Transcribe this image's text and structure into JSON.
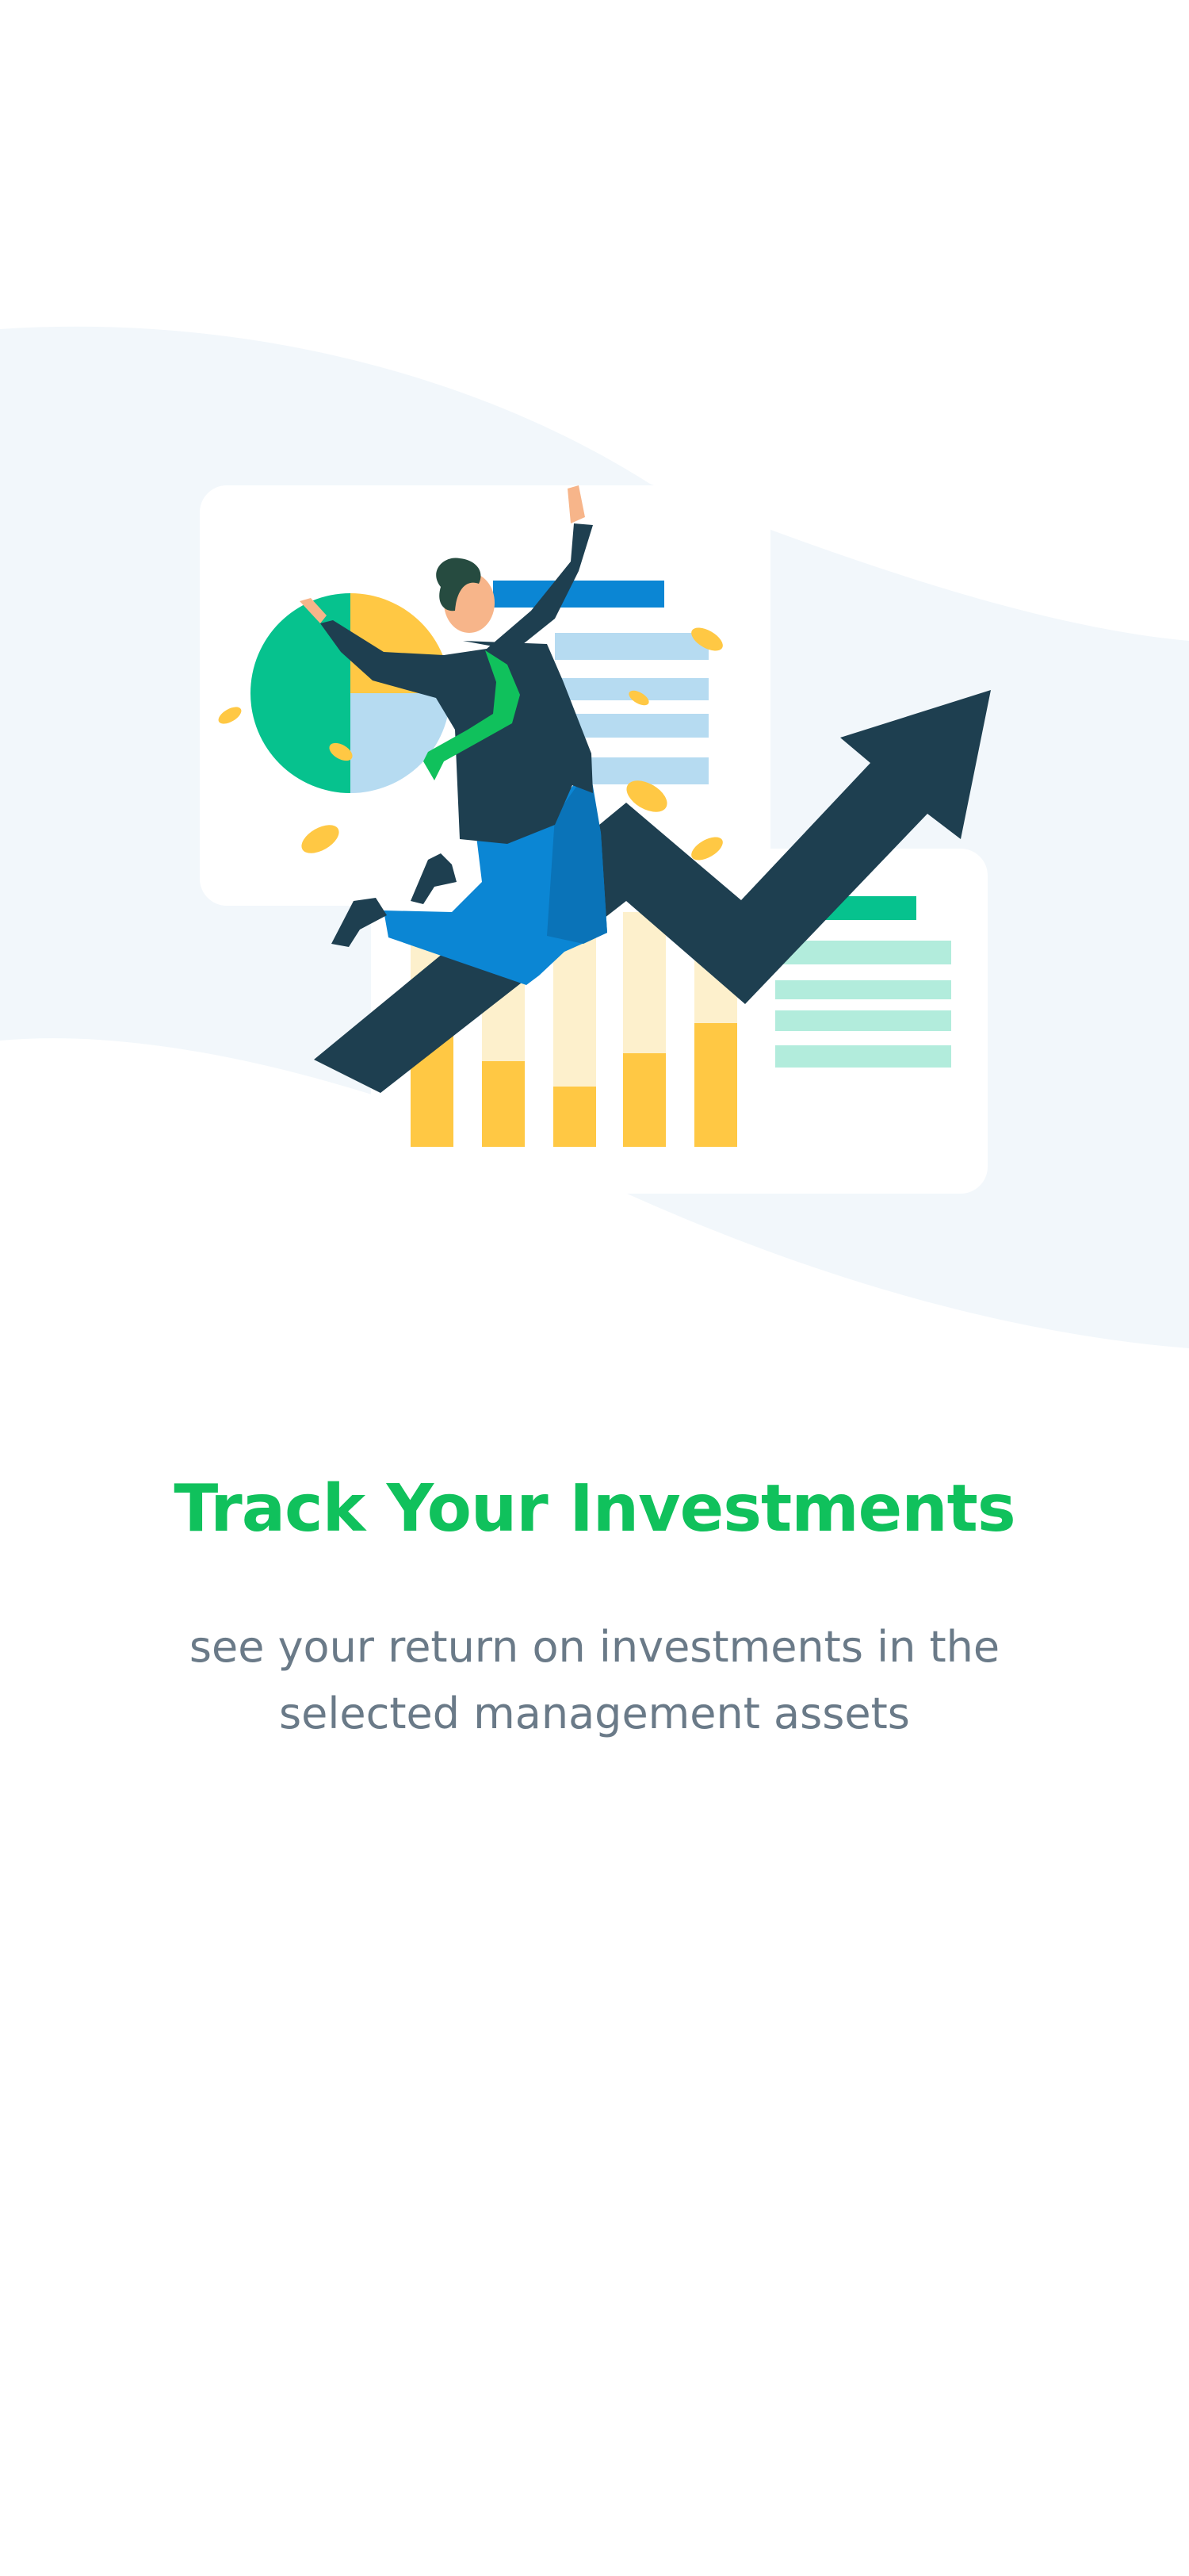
{
  "onboarding": {
    "title": "Track Your Investments",
    "subtitle": "see your return on investments in the selected management assets"
  },
  "colors": {
    "title": "#10c15c",
    "subtitle": "#6a7a88",
    "background_wave": "#f2f7fb",
    "arrow": "#1e3f50",
    "accent_yellow": "#ffc844",
    "accent_green": "#06c28e",
    "accent_blue": "#0b86d4",
    "light_blue": "#b6dbf1",
    "light_green": "#b2ecdc"
  },
  "illustration": {
    "icon": "investment-growth-illustration"
  }
}
